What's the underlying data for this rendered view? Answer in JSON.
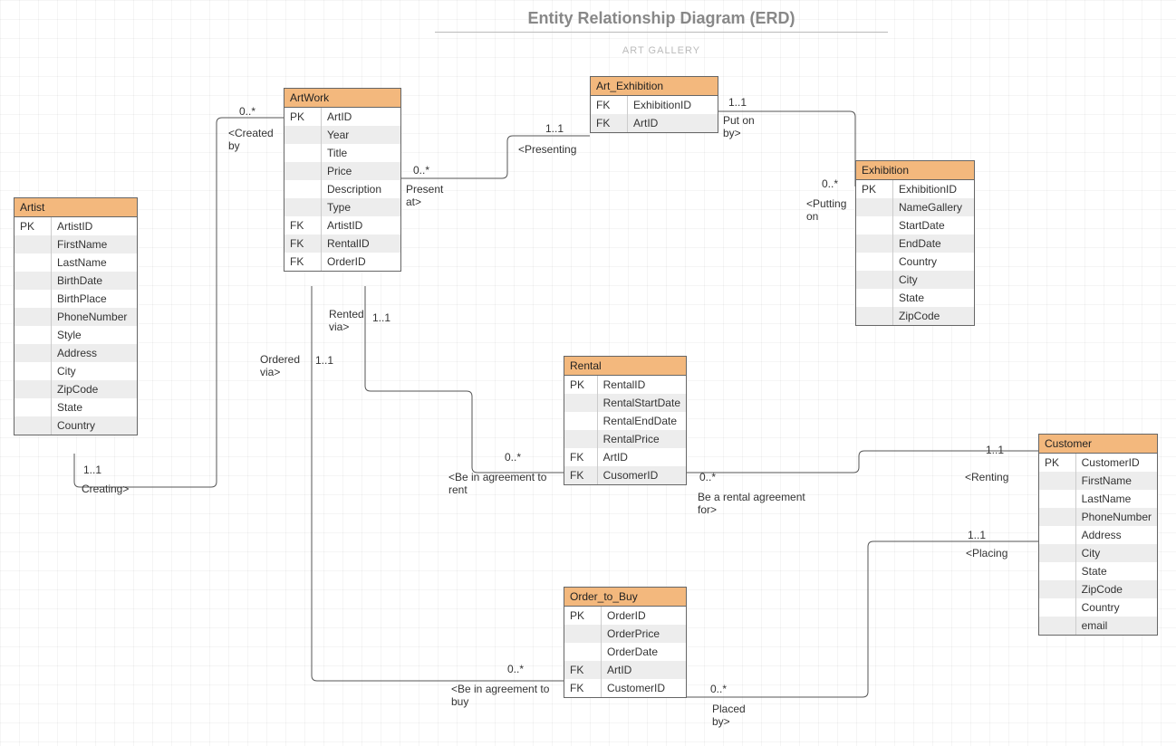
{
  "title": "Entity Relationship Diagram (ERD)",
  "subtitle": "ART GALLERY",
  "artist": {
    "name": "Artist",
    "rows": [
      {
        "key": "PK",
        "field": "ArtistID"
      },
      {
        "key": "",
        "field": "FirstName"
      },
      {
        "key": "",
        "field": "LastName"
      },
      {
        "key": "",
        "field": "BirthDate"
      },
      {
        "key": "",
        "field": "BirthPlace"
      },
      {
        "key": "",
        "field": "PhoneNumber"
      },
      {
        "key": "",
        "field": "Style"
      },
      {
        "key": "",
        "field": "Address"
      },
      {
        "key": "",
        "field": "City"
      },
      {
        "key": "",
        "field": "ZipCode"
      },
      {
        "key": "",
        "field": "State"
      },
      {
        "key": "",
        "field": "Country"
      }
    ]
  },
  "artwork": {
    "name": "ArtWork",
    "rows": [
      {
        "key": "PK",
        "field": "ArtID"
      },
      {
        "key": "",
        "field": "Year"
      },
      {
        "key": "",
        "field": "Title"
      },
      {
        "key": "",
        "field": "Price"
      },
      {
        "key": "",
        "field": "Description"
      },
      {
        "key": "",
        "field": "Type"
      },
      {
        "key": "FK",
        "field": "ArtistID"
      },
      {
        "key": "FK",
        "field": "RentalID"
      },
      {
        "key": "FK",
        "field": "OrderID"
      }
    ]
  },
  "artExhibition": {
    "name": "Art_Exhibition",
    "rows": [
      {
        "key": "FK",
        "field": "ExhibitionID"
      },
      {
        "key": "FK",
        "field": "ArtID"
      }
    ]
  },
  "exhibition": {
    "name": "Exhibition",
    "rows": [
      {
        "key": "PK",
        "field": "ExhibitionID"
      },
      {
        "key": "",
        "field": "NameGallery"
      },
      {
        "key": "",
        "field": "StartDate"
      },
      {
        "key": "",
        "field": "EndDate"
      },
      {
        "key": "",
        "field": "Country"
      },
      {
        "key": "",
        "field": "City"
      },
      {
        "key": "",
        "field": "State"
      },
      {
        "key": "",
        "field": "ZipCode"
      }
    ]
  },
  "rental": {
    "name": "Rental",
    "rows": [
      {
        "key": "PK",
        "field": "RentalID"
      },
      {
        "key": "",
        "field": "RentalStartDate"
      },
      {
        "key": "",
        "field": "RentalEndDate"
      },
      {
        "key": "",
        "field": "RentalPrice"
      },
      {
        "key": "FK",
        "field": "ArtID"
      },
      {
        "key": "FK",
        "field": "CusomerID"
      }
    ]
  },
  "order": {
    "name": "Order_to_Buy",
    "rows": [
      {
        "key": "PK",
        "field": "OrderID"
      },
      {
        "key": "",
        "field": "OrderPrice"
      },
      {
        "key": "",
        "field": "OrderDate"
      },
      {
        "key": "FK",
        "field": "ArtID"
      },
      {
        "key": "FK",
        "field": "CustomerID"
      }
    ]
  },
  "customer": {
    "name": "Customer",
    "rows": [
      {
        "key": "PK",
        "field": "CustomerID"
      },
      {
        "key": "",
        "field": "FirstName"
      },
      {
        "key": "",
        "field": "LastName"
      },
      {
        "key": "",
        "field": "PhoneNumber"
      },
      {
        "key": "",
        "field": "Address"
      },
      {
        "key": "",
        "field": "City"
      },
      {
        "key": "",
        "field": "State"
      },
      {
        "key": "",
        "field": "ZipCode"
      },
      {
        "key": "",
        "field": "Country"
      },
      {
        "key": "",
        "field": "email"
      }
    ]
  },
  "labels": {
    "createdBy": "<Created\nby",
    "createdByCard": "0..*",
    "creating": "Creating>",
    "creatingCard": "1..1",
    "presentAt": "Present\nat>",
    "presentAtCard": "0..*",
    "presenting": "<Presenting",
    "presentingCard": "1..1",
    "putOnBy": "Put on\nby>",
    "putOnByCard": "1..1",
    "puttingOn": "<Putting\non",
    "puttingOnCard": "0..*",
    "rentedVia": "Rented\nvia>",
    "rentedViaCard": "1..1",
    "agreeRent": "<Be in agreement to\nrent",
    "agreeRentCard": "0..*",
    "orderedVia": "Ordered\nvia>",
    "orderedViaCard": "1..1",
    "agreeBuy": "<Be in agreement to\nbuy",
    "agreeBuyCard": "0..*",
    "rentalFor": "Be a rental agreement\nfor>",
    "rentalForCard": "0..*",
    "renting": "<Renting",
    "rentingCard": "1..1",
    "placedBy": "Placed\nby>",
    "placedByCard": "0..*",
    "placing": "<Placing",
    "placingCard": "1..1"
  }
}
